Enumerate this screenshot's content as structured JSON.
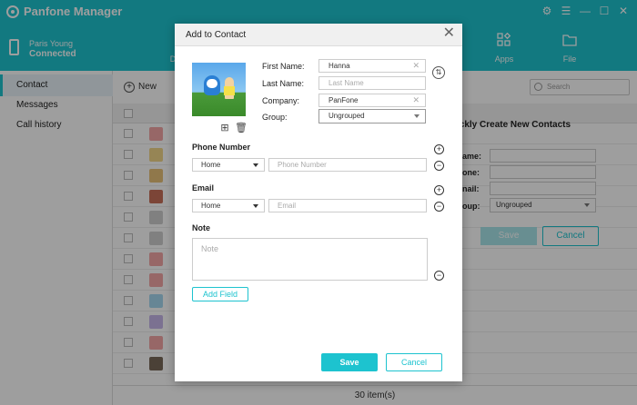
{
  "app": {
    "title": "Panfone Manager"
  },
  "device": {
    "name": "Paris Young",
    "status": "Connected"
  },
  "nav": {
    "items": [
      {
        "label": "D"
      },
      {
        "label": "Apps"
      },
      {
        "label": "File"
      }
    ]
  },
  "sidebar": {
    "items": [
      {
        "label": "Contact"
      },
      {
        "label": "Messages"
      },
      {
        "label": "Call history"
      }
    ]
  },
  "main": {
    "new_label": "New",
    "search_placeholder": "Search",
    "right_panel": {
      "title": "ickly Create New Contacts",
      "labels": [
        "ame:",
        "one:",
        "nail:",
        "oup:"
      ],
      "group_value": "Ungrouped",
      "save_label": "Save",
      "cancel_label": "Cancel"
    },
    "footer": "30 item(s)"
  },
  "modal": {
    "title": "Add to Contact",
    "fields": {
      "first_name_label": "First Name:",
      "first_name_value": "Hanna",
      "last_name_label": "Last Name:",
      "last_name_placeholder": "Last Name",
      "company_label": "Company:",
      "company_value": "PanFone",
      "group_label": "Group:",
      "group_value": "Ungrouped"
    },
    "phone": {
      "label": "Phone Number",
      "type": "Home",
      "placeholder": "Phone Number"
    },
    "email": {
      "label": "Email",
      "type": "Home",
      "placeholder": "Email"
    },
    "note": {
      "label": "Note",
      "placeholder": "Note"
    },
    "add_field_label": "Add Field",
    "save_label": "Save",
    "cancel_label": "Cancel"
  },
  "colors": {
    "accent": "#1dc3cf"
  }
}
